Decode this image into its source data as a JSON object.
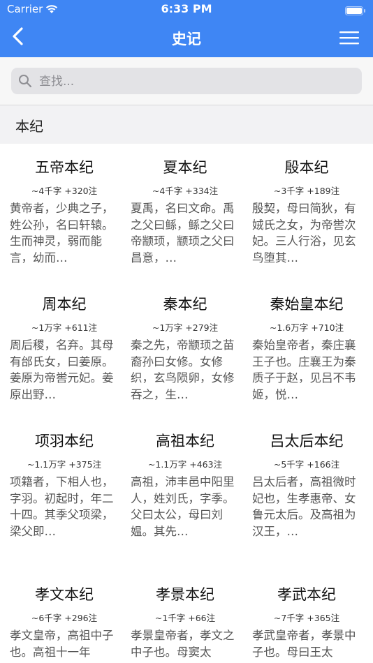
{
  "status_bar": {
    "carrier": "Carrier",
    "time": "6:33 PM"
  },
  "nav": {
    "title": "史记"
  },
  "search": {
    "placeholder": "查找..."
  },
  "section": {
    "title": "本纪"
  },
  "items": [
    {
      "title": "五帝本纪",
      "meta": "~4千字 +320注",
      "excerpt": "黄帝者，少典之子，姓公孙，名曰轩辕。生而神灵，弱而能言，幼而…"
    },
    {
      "title": "夏本纪",
      "meta": "~4千字 +334注",
      "excerpt": "夏禹，名曰文命。禹之父曰鲧，鲧之父曰帝颛顼，颛顼之父曰昌意，…"
    },
    {
      "title": "殷本纪",
      "meta": "~3千字 +189注",
      "excerpt": "殷契，母曰简狄，有娀氏之女，为帝喾次妃。三人行浴，见玄鸟堕其…"
    },
    {
      "title": "周本纪",
      "meta": "~1万字 +611注",
      "excerpt": "周后稷，名弃。其母有邰氏女，曰姜原。姜原为帝喾元妃。姜原出野…"
    },
    {
      "title": "秦本纪",
      "meta": "~1万字 +279注",
      "excerpt": "秦之先，帝颛顼之苗裔孙曰女修。女修织，玄鸟陨卵，女修吞之，生…"
    },
    {
      "title": "秦始皇本纪",
      "meta": "~1.6万字 +710注",
      "excerpt": "秦始皇帝者，秦庄襄王子也。庄襄王为秦质子于赵，见吕不韦姬，悦…"
    },
    {
      "title": "项羽本纪",
      "meta": "~1.1万字 +375注",
      "excerpt": "项籍者，下相人也，字羽。初起时，年二十四。其季父项梁，梁父即…"
    },
    {
      "title": "高祖本纪",
      "meta": "~1.1万字 +463注",
      "excerpt": "高祖，沛丰邑中阳里人，姓刘氏，字季。父曰太公，母曰刘媪。其先…"
    },
    {
      "title": "吕太后本纪",
      "meta": "~5千字 +166注",
      "excerpt": "吕太后者，高祖微时妃也，生孝惠帝、女鲁元太后。及高祖为汉王，…"
    },
    {
      "title": "孝文本纪",
      "meta": "~6千字 +296注",
      "excerpt": "孝文皇帝，高祖中子也。高祖十一年"
    },
    {
      "title": "孝景本纪",
      "meta": "~1千字 +66注",
      "excerpt": "孝景皇帝者，孝文之中子也。母窦太"
    },
    {
      "title": "孝武本纪",
      "meta": "~7千字 +365注",
      "excerpt": "孝武皇帝者，孝景中子也。母曰王太"
    }
  ],
  "colors": {
    "accent": "#3f86f4",
    "section_bg": "#f2f2f4",
    "search_bg": "#e3e3e6"
  },
  "icons": [
    "wifi-icon",
    "battery-icon",
    "back-chevron-icon",
    "menu-icon",
    "search-icon"
  ]
}
